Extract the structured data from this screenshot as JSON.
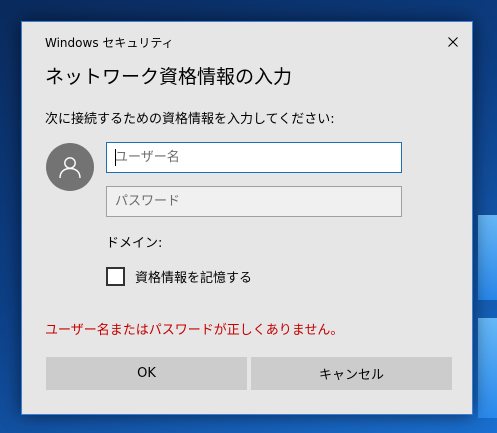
{
  "window": {
    "title": "Windows セキュリティ",
    "heading": "ネットワーク資格情報の入力",
    "instruction": "次に接続するための資格情報を入力してください:"
  },
  "form": {
    "username_placeholder": "ユーザー名",
    "username_value": "",
    "password_placeholder": "パスワード",
    "password_value": "",
    "domain_label": "ドメイン:",
    "remember_label": "資格情報を記憶する",
    "remember_checked": false
  },
  "error_message": "ユーザー名またはパスワードが正しくありません。",
  "buttons": {
    "ok_label": "OK",
    "cancel_label": "キャンセル"
  },
  "icons": [
    "close-icon",
    "user-avatar-icon"
  ],
  "colors": {
    "dialog_bg": "#e6e6e6",
    "error_text": "#c50000",
    "focus_border": "#1a6fb5",
    "button_bg": "#cccccc",
    "avatar_bg": "#737373"
  }
}
